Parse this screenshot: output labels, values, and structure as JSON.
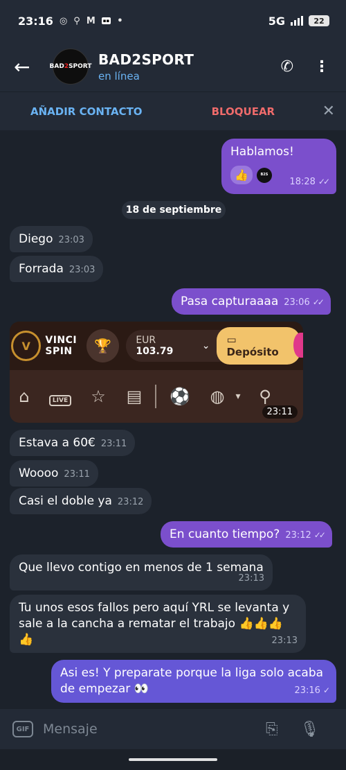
{
  "status_bar": {
    "time": "23:16",
    "network": "5G",
    "battery": "22"
  },
  "header": {
    "title": "BAD2SPORT",
    "subtitle": "en línea",
    "avatar_text_1": "BAD",
    "avatar_text_2": "2",
    "avatar_text_3": "SPORT"
  },
  "actionbar": {
    "add_contact": "AÑADIR CONTACTO",
    "block": "BLOQUEAR"
  },
  "messages": {
    "m1": {
      "text": "Hablamos!",
      "time": "18:28",
      "reaction": "👍"
    },
    "date": "18 de septiembre",
    "m2": {
      "text": "Diego",
      "time": "23:03"
    },
    "m3": {
      "text": "Forrada",
      "time": "23:03"
    },
    "m4": {
      "text": "Pasa capturaaaa",
      "time": "23:06"
    },
    "media": {
      "brand_line1": "VINCI",
      "brand_line2": "SPIN",
      "currency": "EUR",
      "balance": "103.79",
      "deposit": "Depósito",
      "live": "LIVE",
      "time": "23:11"
    },
    "m5": {
      "text": "Estava a 60€",
      "time": "23:11"
    },
    "m6": {
      "text": "Woooo",
      "time": "23:11"
    },
    "m7": {
      "text": "Casi el doble ya",
      "time": "23:12"
    },
    "m8": {
      "text": "En cuanto tiempo?",
      "time": "23:12"
    },
    "m9": {
      "text": "Que llevo contigo en menos de 1 semana",
      "time": "23:13"
    },
    "m10": {
      "text": "Tu unos esos fallos pero aquí YRL se levanta y sale a la cancha a rematar el trabajo 👍👍👍👍",
      "time": "23:13"
    },
    "m11": {
      "text": "Asi es! Y preparate porque la liga solo acaba de empezar 👀",
      "time": "23:16"
    }
  },
  "composer": {
    "gif": "GIF",
    "placeholder": "Mensaje"
  },
  "colors": {
    "outgoing_bubble": "#7b4fcc",
    "incoming_bubble": "#2a313c",
    "link_blue": "#6ab3f3",
    "block_red": "#ef6b6b"
  }
}
